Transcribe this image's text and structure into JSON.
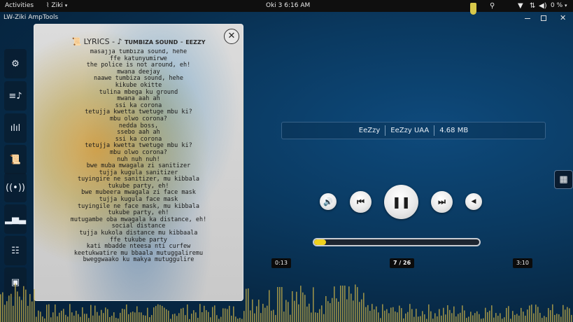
{
  "topbar": {
    "activities": "Activities",
    "app_name": "Ziki",
    "clock": "Oki 3  6:16 AM",
    "battery": "0 %",
    "icons": [
      "shield-icon",
      "accessibility-icon",
      "wifi-icon",
      "network-icon",
      "volume-icon",
      "battery-icon",
      "chevron-down-icon"
    ]
  },
  "window": {
    "title": "LW-Ziki Amp",
    "menu_tools": "Tools"
  },
  "sidebar": {
    "items": [
      {
        "name": "settings",
        "icon": "gear-icon"
      },
      {
        "name": "playlist",
        "icon": "playlist-icon"
      },
      {
        "name": "equalizer",
        "icon": "waveform-icon"
      },
      {
        "name": "lyrics",
        "icon": "scroll-icon"
      },
      {
        "name": "radio",
        "icon": "broadcast-icon"
      },
      {
        "name": "stats",
        "icon": "bar-chart-icon"
      },
      {
        "name": "mixer",
        "icon": "sliders-icon"
      },
      {
        "name": "feedback",
        "icon": "message-icon"
      }
    ]
  },
  "lyrics": {
    "label": "LYRICS",
    "title": "TUMBIZA SOUND",
    "artist": "EEZZY",
    "lines": [
      "masajja tumbiza sound, hehe",
      "ffe katunyumirwe",
      "the police is not around, eh!",
      "mwana deejay",
      "naawe tumbiza sound, hehe",
      "kikube okitte",
      "tulina mbega ku ground",
      "mwana aah ah",
      "ssi ka corona",
      "tetujja kwetta twetuge mbu ki?",
      "mbu olwo corona?",
      "nedda boss,",
      "ssebo aah ah",
      "ssi ka corona",
      "tetujja kwetta twetuge mbu ki?",
      "mbu olwo corona?",
      "nuh nuh nuh!",
      "bwe muba mwagala zi sanitizer",
      "tujja kugula sanitizer",
      "tuyingire ne sanitizer, mu kibbala",
      "tukube party, eh!",
      "bwe mubeera mwagala zi face mask",
      "tujja kugula face mask",
      "tuyingile ne face mask, mu kibbala",
      "tukube party, eh!",
      "mutugambe oba mwagala ka distance, eh!",
      "social distance",
      "tujja kukola distance mu kibbaala",
      "ffe tukube party",
      "kati mbadde nteesa nti curfew",
      "keetukwatire mu bbaala mutuggaliremu",
      "bweggwaako ku makya mutuggulire"
    ]
  },
  "track_info": {
    "artist": "EeZzy",
    "album": "EeZzy UAA",
    "size": "4.68 MB"
  },
  "player": {
    "elapsed": "0:13",
    "track_position": "7 / 26",
    "total": "3:10",
    "progress": 0.07,
    "accent_color": "#f0d21e"
  }
}
